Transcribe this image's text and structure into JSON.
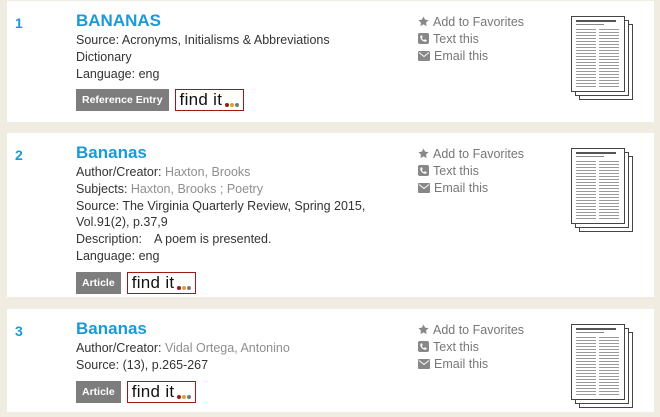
{
  "actions": {
    "favorite": "Add to Favorites",
    "text": "Text this",
    "email": "Email this"
  },
  "find_it": {
    "label": "find it",
    "dot_colors": [
      "#a01818",
      "#d6a33a",
      "#7a7a7a"
    ]
  },
  "colors": {
    "title": "#1a9ad6",
    "background": "#f1ece1",
    "badge": "#7d7d7d"
  },
  "results": [
    {
      "number": "1",
      "title": "BANANAS",
      "source_label": "Source:",
      "source_line1": "Acronyms, Initialisms & Abbreviations",
      "source_line2": "Dictionary",
      "language_label": "Language:",
      "language": "eng",
      "badge": "Reference Entry"
    },
    {
      "number": "2",
      "title": "Bananas",
      "author_label": "Author/Creator:",
      "author": "Haxton, Brooks",
      "subjects_label": "Subjects:",
      "subject1": "Haxton, Brooks",
      "subject_sep": ";",
      "subject2": "Poetry",
      "source_label": "Source:",
      "source_line1": "The Virginia Quarterly Review, Spring 2015,",
      "source_line2": "Vol.91(2), p.37,9",
      "description_label": "Description:",
      "description": "A poem is presented.",
      "language_label": "Language:",
      "language": "eng",
      "badge": "Article"
    },
    {
      "number": "3",
      "title": "Bananas",
      "author_label": "Author/Creator:",
      "author": "Vidal Ortega, Antonino",
      "source_label": "Source:",
      "source_line1": "(13), p.265-267",
      "badge": "Article"
    }
  ]
}
